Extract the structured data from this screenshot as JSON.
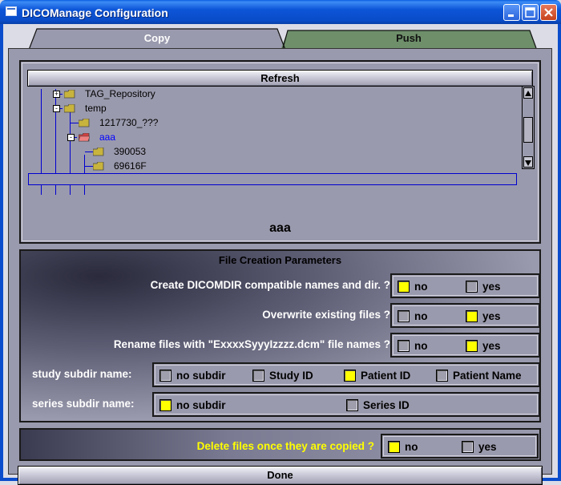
{
  "window": {
    "title": "DICOManage Configuration",
    "buttons": [
      "minimize",
      "maximize",
      "close"
    ]
  },
  "tabs": [
    {
      "label": "Copy",
      "active": true
    },
    {
      "label": "Push",
      "active": false
    }
  ],
  "browser": {
    "refresh_label": "Refresh",
    "tree": [
      {
        "label": "TAG_Repository",
        "expander": "+",
        "selected": false
      },
      {
        "label": "temp",
        "expander": "-",
        "selected": false
      },
      {
        "label": "1217730_???",
        "expander": "",
        "selected": false
      },
      {
        "label": "aaa",
        "expander": "-",
        "selected": true
      },
      {
        "label": "390053",
        "expander": "",
        "selected": false
      },
      {
        "label": "69616F",
        "expander": "",
        "selected": false
      }
    ],
    "selected_name": "aaa"
  },
  "params": {
    "title": "File Creation Parameters",
    "dicomdir": {
      "label": "Create DICOMDIR compatible names and dir. ?",
      "options": [
        "no",
        "yes"
      ],
      "selected": "no"
    },
    "overwrite": {
      "label": "Overwrite existing files ?",
      "options": [
        "no",
        "yes"
      ],
      "selected": "yes"
    },
    "rename": {
      "label": "Rename files with \"ExxxxSyyyIzzzz.dcm\" file names ?",
      "options": [
        "no",
        "yes"
      ],
      "selected": "yes"
    },
    "study": {
      "label": "study subdir name:",
      "options": [
        "no subdir",
        "Study ID",
        "Patient ID",
        "Patient Name"
      ],
      "selected": "Patient ID"
    },
    "series": {
      "label": "series subdir name:",
      "options": [
        "no subdir",
        "Series ID"
      ],
      "selected": "no subdir"
    }
  },
  "delete": {
    "label": "Delete files once they are copied ?",
    "options": [
      "no",
      "yes"
    ],
    "selected": "no"
  },
  "done_label": "Done",
  "colors": {
    "checked": "#ffff00",
    "panel": "#9a9aae",
    "titlebar": "#0a4cc8",
    "highlight_text": "#ffff00",
    "selected_tree": "#0000ff"
  }
}
